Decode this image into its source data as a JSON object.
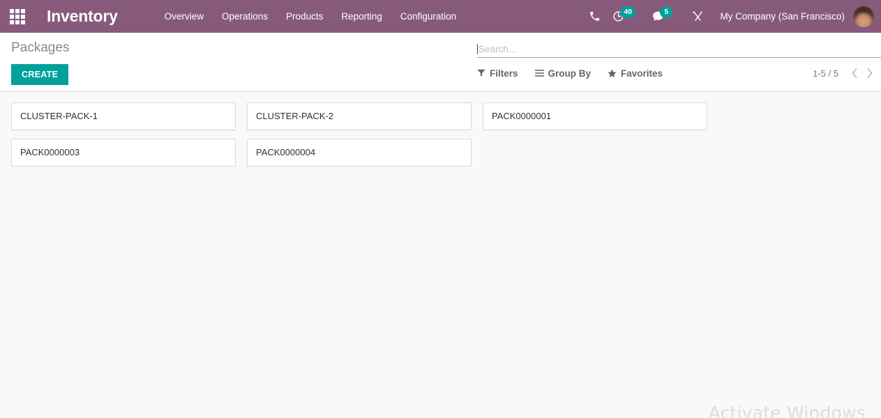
{
  "navbar": {
    "apps_icon": "apps-grid-icon",
    "brand": "Inventory",
    "menu_items": [
      {
        "label": "Overview"
      },
      {
        "label": "Operations"
      },
      {
        "label": "Products"
      },
      {
        "label": "Reporting"
      },
      {
        "label": "Configuration"
      }
    ],
    "system_icons": [
      {
        "name": "phone-icon",
        "badge": null
      },
      {
        "name": "activity-clock-icon",
        "badge": "40"
      },
      {
        "name": "messages-bubble-icon",
        "badge": "5"
      },
      {
        "name": "tools-icon",
        "badge": null
      }
    ],
    "company": "My Company (San Francisco)",
    "avatar": "user-avatar",
    "background_color": "#875A7B"
  },
  "control_panel": {
    "breadcrumb": "Packages",
    "create_label": "CREATE",
    "create_color": "#00A09D",
    "search": {
      "value": "",
      "placeholder": "Search..."
    },
    "filters": [
      {
        "label": "Filters",
        "icon": "funnel-icon"
      },
      {
        "label": "Group By",
        "icon": "list-lines-icon"
      },
      {
        "label": "Favorites",
        "icon": "star-icon"
      }
    ],
    "pager": {
      "count": "1-5 / 5",
      "previous_icon": "chevron-left-icon",
      "next_icon": "chevron-right-icon"
    }
  },
  "kanban": {
    "cards": [
      {
        "title": "CLUSTER-PACK-1"
      },
      {
        "title": "CLUSTER-PACK-2"
      },
      {
        "title": "PACK0000001"
      },
      {
        "title": "PACK0000003"
      },
      {
        "title": "PACK0000004"
      }
    ]
  },
  "watermark": {
    "line1": "Activate Windows"
  }
}
